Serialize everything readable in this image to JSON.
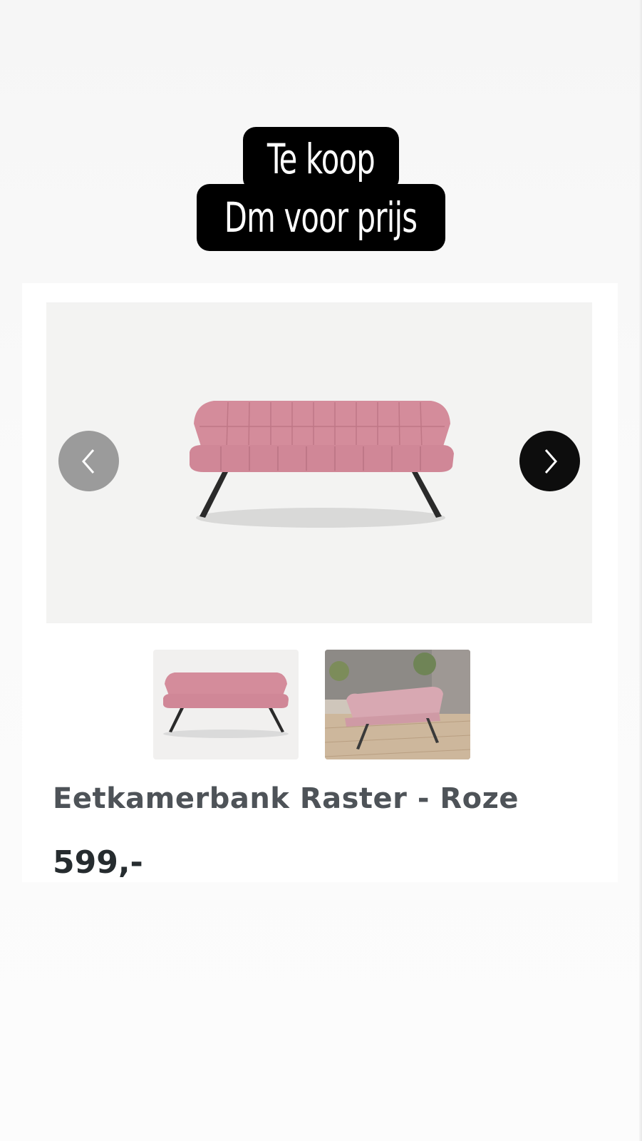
{
  "story_sticker": {
    "line1": "Te koop",
    "line2": "Dm voor prijs"
  },
  "product": {
    "title": "Eetkamerbank Raster - Roze",
    "price": "599,-"
  },
  "gallery": {
    "prev_icon": "chevron-left-icon",
    "next_icon": "chevron-right-icon",
    "thumbnail_count": 2
  },
  "colors": {
    "sticker_bg": "#000000",
    "sticker_text": "#ffffff",
    "bench_pink": "#d58b99",
    "prev_button": "#9b9b9b",
    "next_button": "#0d0d0d",
    "title": "#4e5358",
    "price": "#262c2f"
  }
}
